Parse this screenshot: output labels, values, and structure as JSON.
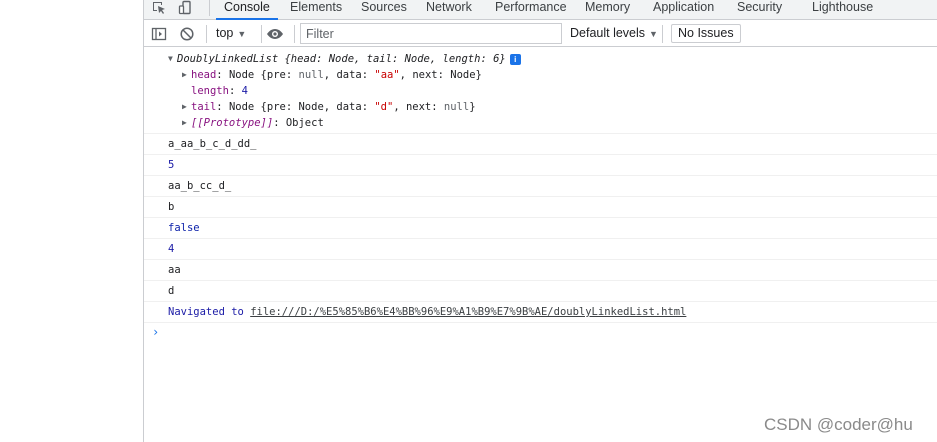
{
  "tabs": [
    "Console",
    "Elements",
    "Sources",
    "Network",
    "Performance",
    "Memory",
    "Application",
    "Security",
    "Lighthouse"
  ],
  "active_tab": "Console",
  "toolbar": {
    "context": "top",
    "filter_placeholder": "Filter",
    "levels_label": "Default levels",
    "issues_label": "No Issues"
  },
  "object_log": {
    "summary_name": "DoublyLinkedList",
    "summary_fields": "{head: Node, tail: Node, length: 6}",
    "head_key": "head",
    "head_value_prefix": "Node {pre: ",
    "head_pre": "null",
    "head_mid": ", data: ",
    "head_data": "\"aa\"",
    "head_end": ", next: Node}",
    "length_key": "length",
    "length_value": "4",
    "tail_key": "tail",
    "tail_value_prefix": "Node {pre: Node, data: ",
    "tail_data": "\"d\"",
    "tail_mid": ", next: ",
    "tail_next": "null",
    "tail_end": "}",
    "proto_key": "[[Prototype]]",
    "proto_value": "Object"
  },
  "logs": [
    {
      "text": "a_aa_b_c_d_dd_",
      "kind": "str"
    },
    {
      "text": "5",
      "kind": "num"
    },
    {
      "text": "aa_b_cc_d_",
      "kind": "str"
    },
    {
      "text": "b",
      "kind": "str"
    },
    {
      "text": "false",
      "kind": "kw"
    },
    {
      "text": "4",
      "kind": "num"
    },
    {
      "text": "aa",
      "kind": "str"
    },
    {
      "text": "d",
      "kind": "str"
    }
  ],
  "navigation": {
    "label": "Navigated to",
    "url": "file:///D:/%E5%85%B6%E4%BB%96%E9%A1%B9%E7%9B%AE/doublyLinkedList.html"
  },
  "prompt_symbol": "›",
  "watermark": "CSDN @coder@hu"
}
